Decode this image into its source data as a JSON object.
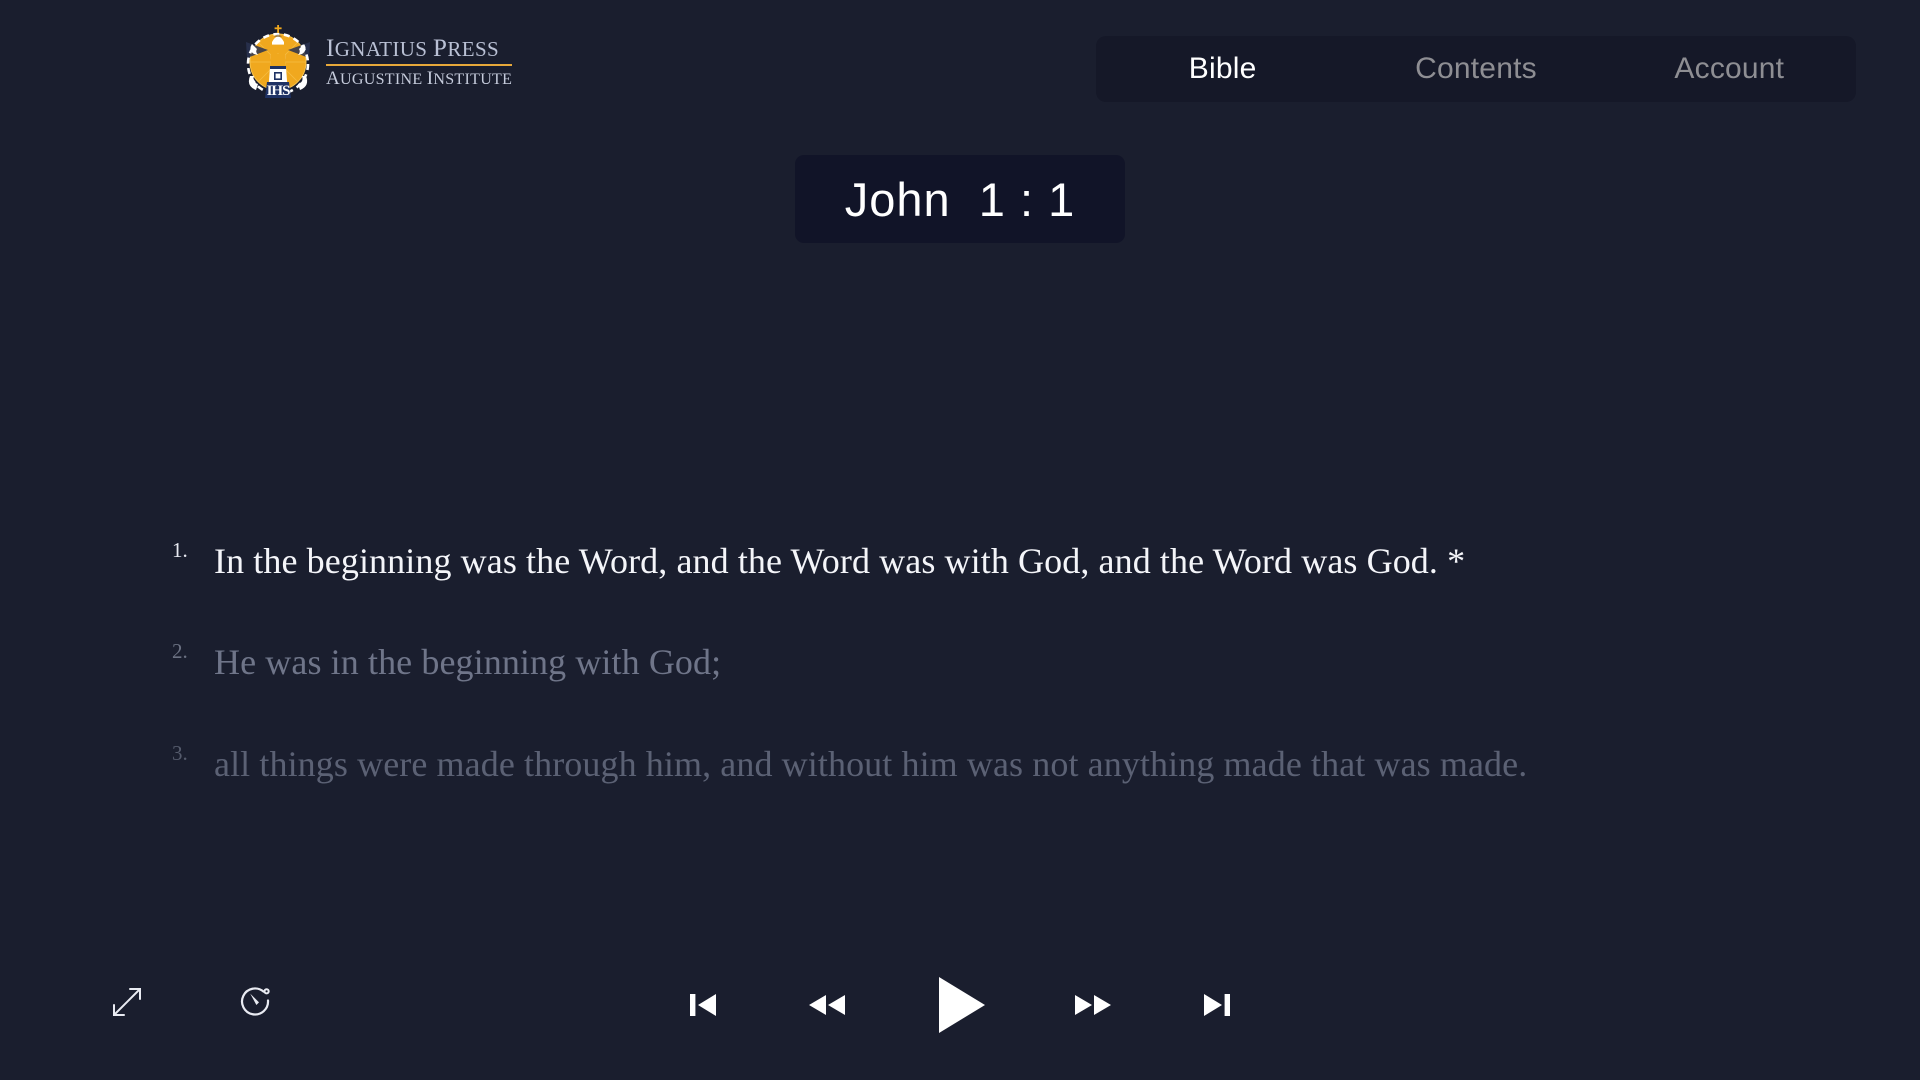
{
  "app": {
    "background_color": "#1a1e2e",
    "panel_color": "#151828",
    "chip_color": "#111428",
    "accent_color": "#e7a83a"
  },
  "brand": {
    "name": "brand-logo",
    "line1": "Ignatius Press",
    "line2": "Augustine Institute",
    "emblem": "lighthouse-ihs-emblem"
  },
  "nav": {
    "items": [
      {
        "label": "Bible",
        "active": true,
        "name": "tab-bible"
      },
      {
        "label": "Contents",
        "active": false,
        "name": "tab-contents"
      },
      {
        "label": "Account",
        "active": false,
        "name": "tab-account"
      }
    ]
  },
  "reference": {
    "text": "John  1 : 1",
    "book": "John",
    "chapter": "1",
    "verse": "1"
  },
  "verses": [
    {
      "number": "1.",
      "text": "In the beginning was the Word, and the Word was with God, and the Word was God. *",
      "state": "current"
    },
    {
      "number": "2.",
      "text": "He was in the beginning with God;",
      "state": "dim1"
    },
    {
      "number": "3.",
      "text": "all things were made through him, and without him was not anything made that was made.",
      "state": "dim2"
    }
  ],
  "player": {
    "left_controls": [
      {
        "name": "fullscreen-icon",
        "label": "Fullscreen"
      },
      {
        "name": "playback-speed-icon",
        "label": "Playback speed"
      }
    ],
    "transport": [
      {
        "name": "skip-previous-icon",
        "label": "Previous"
      },
      {
        "name": "rewind-icon",
        "label": "Rewind"
      },
      {
        "name": "play-icon",
        "label": "Play"
      },
      {
        "name": "fast-forward-icon",
        "label": "Fast forward"
      },
      {
        "name": "skip-next-icon",
        "label": "Next"
      }
    ],
    "state": "paused"
  }
}
